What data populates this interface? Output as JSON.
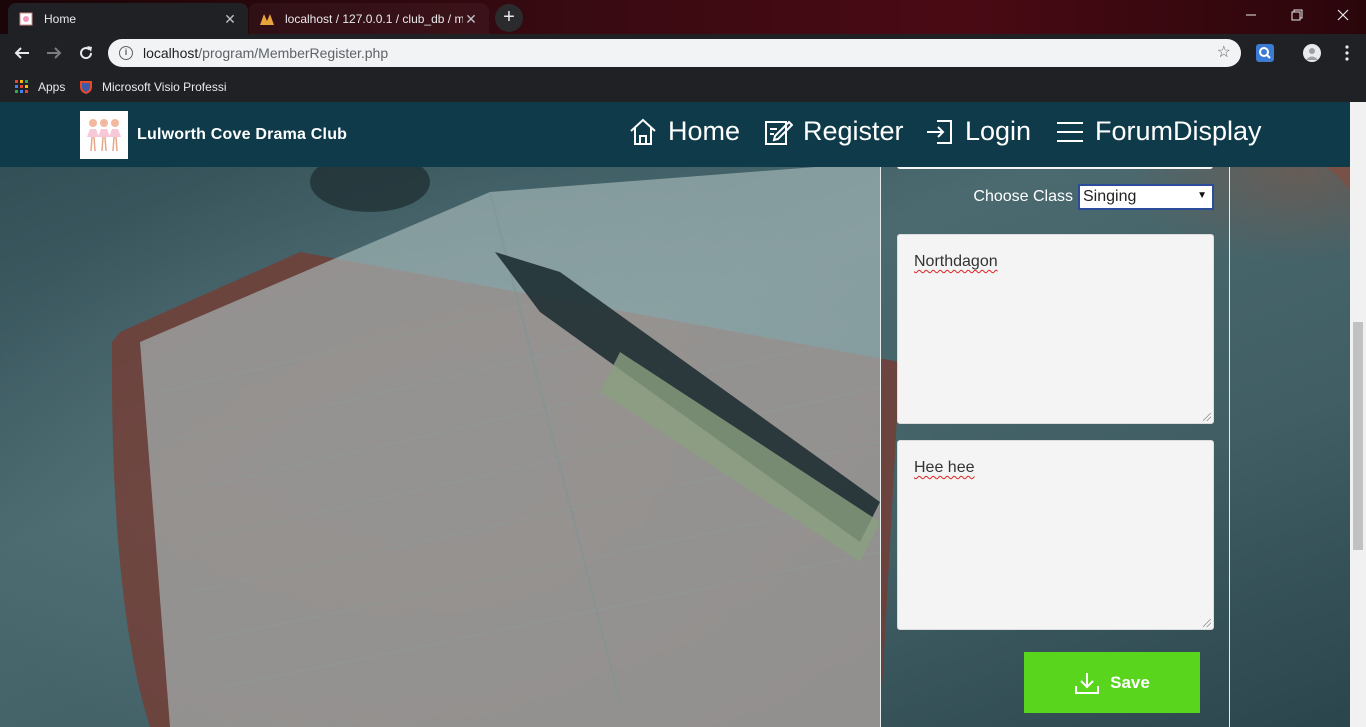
{
  "browser": {
    "tabs": [
      {
        "title": "Home",
        "active": true
      },
      {
        "title": "localhost / 127.0.0.1 / club_db / me",
        "active": false
      }
    ],
    "new_tab": "+",
    "address": {
      "host": "localhost",
      "path": "/program/MemberRegister.php"
    },
    "bookmarks": [
      {
        "label": "Apps",
        "icon": "apps-grid-icon"
      },
      {
        "label": "Microsoft Visio Professi",
        "icon": "visio-shield-icon"
      }
    ]
  },
  "site": {
    "brand": "Lulworth Cove Drama Club",
    "nav": [
      {
        "label": "Home",
        "icon": "home-icon"
      },
      {
        "label": "Register",
        "icon": "edit-icon"
      },
      {
        "label": "Login",
        "icon": "login-icon"
      },
      {
        "label": "ForumDisplay",
        "icon": "menu-icon"
      }
    ]
  },
  "form": {
    "class_label": "Choose Class",
    "class_value": "Singing",
    "address_value": "Northdagon",
    "comment_value": "Hee hee",
    "save_label": "Save"
  },
  "colors": {
    "navbar": "#0e3a4a",
    "save": "#5ad51e",
    "select_border": "#2b4c9a"
  }
}
